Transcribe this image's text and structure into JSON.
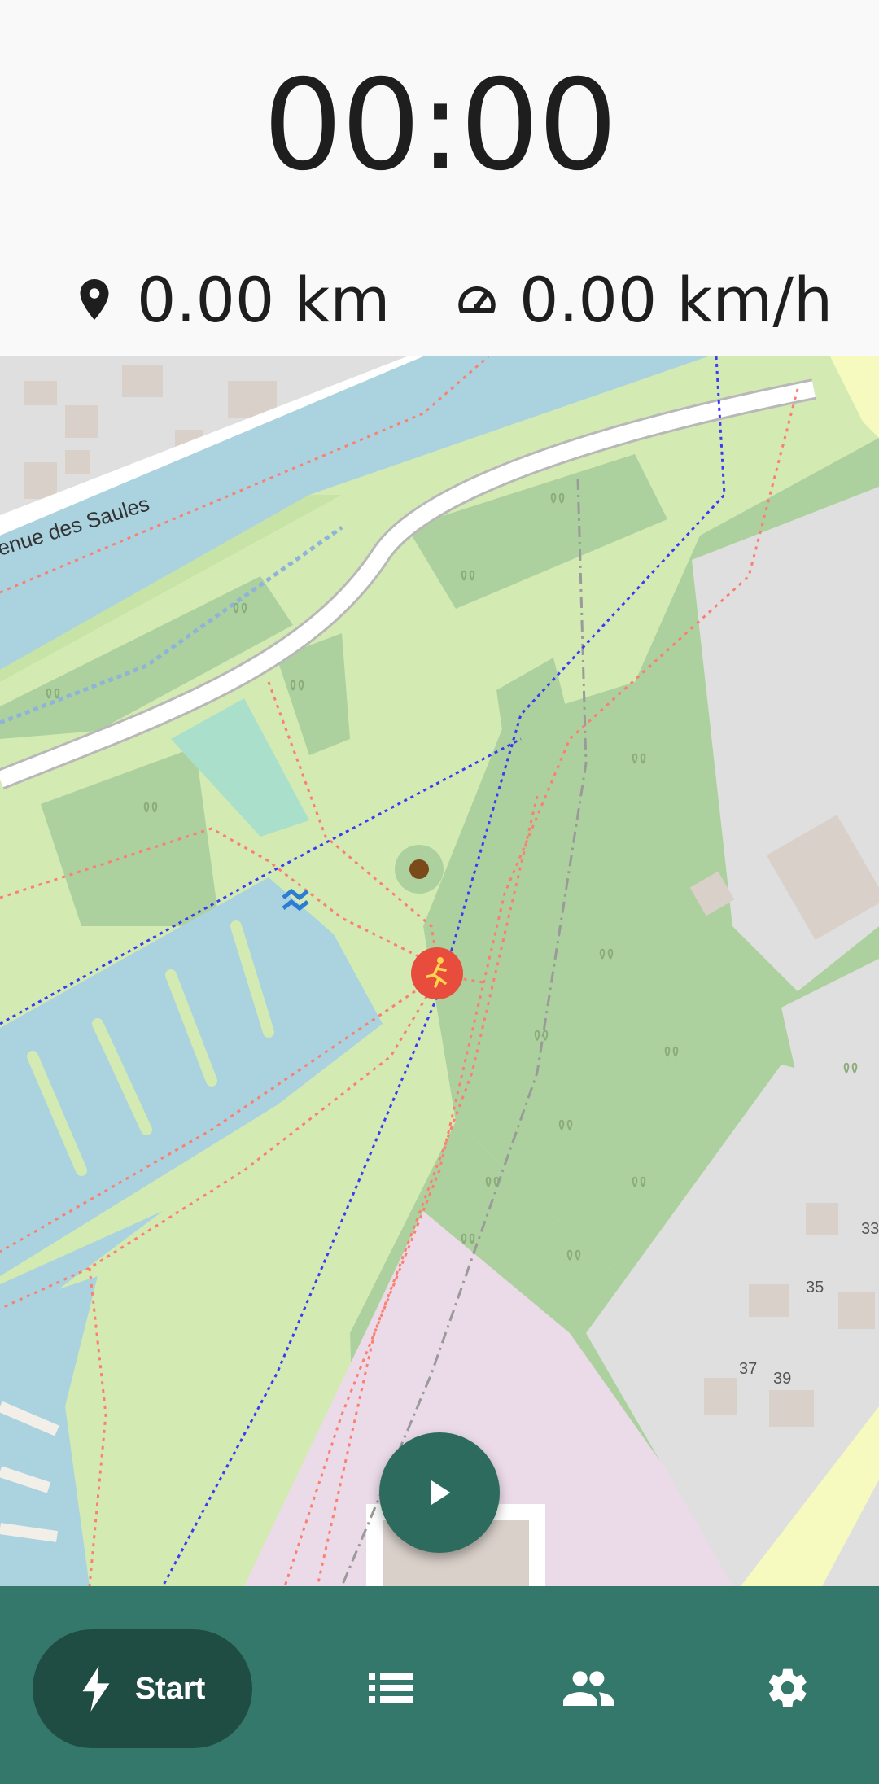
{
  "timer": {
    "value": "00:00"
  },
  "stats": {
    "distance": {
      "value": "0.00 km",
      "icon": "location-pin-icon"
    },
    "speed": {
      "value": "0.00 km/h",
      "icon": "speedometer-icon"
    }
  },
  "map": {
    "street_label": "enue des Saules",
    "house_numbers": [
      "33",
      "35",
      "37",
      "39"
    ],
    "marker_icon": "runner-icon",
    "colors": {
      "park": "#d4eab3",
      "forest": "#add19e",
      "water": "#aad3df",
      "building": "#d9d0c9",
      "industrial": "#e0dfdf",
      "path_foot": "#fa8072",
      "path_cycle": "#3b3bf5",
      "residential": "#ebdbe8",
      "marker": "#e74c3c"
    }
  },
  "fab": {
    "icon": "play-icon"
  },
  "bottom_nav": {
    "start": {
      "label": "Start",
      "icon": "lightning-icon"
    },
    "list_icon": "list-icon",
    "people_icon": "people-icon",
    "settings_icon": "gear-icon"
  },
  "colors": {
    "nav_bg": "#34786b",
    "nav_active": "#1f4d43",
    "fab": "#2c6b5e"
  }
}
